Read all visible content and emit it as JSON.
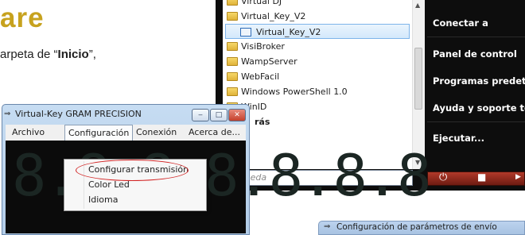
{
  "doc": {
    "title": "are",
    "text_prefix": "arpeta de “",
    "text_bold": "Inicio",
    "text_suffix": "”,",
    "title_color": "#c7a21e"
  },
  "start_menu": {
    "programs": [
      {
        "label": "Virtual DJ",
        "icon": "folder-icon"
      },
      {
        "label": "Virtual_Key_V2",
        "icon": "folder-icon"
      },
      {
        "label": "Virtual_Key_V2",
        "icon": "app-icon",
        "selected": true
      },
      {
        "label": "VisiBroker",
        "icon": "folder-icon"
      },
      {
        "label": "WampServer",
        "icon": "folder-icon"
      },
      {
        "label": "WebFacil",
        "icon": "folder-icon"
      },
      {
        "label": "Windows PowerShell 1.0",
        "icon": "folder-icon"
      },
      {
        "label": "WinID",
        "icon": "folder-icon"
      },
      {
        "label": "rás",
        "icon": "none"
      }
    ],
    "search_placeholder": "úsqueda",
    "right_items": [
      "Conectar a",
      "Panel de control",
      "Programas predeterm",
      "Ayuda y soporte técni",
      "Ejecutar..."
    ],
    "power_icon": "power-icon",
    "lock_icon": "lock-icon",
    "arrow_icon": "arrow-right-icon"
  },
  "vk_window": {
    "title": "Virtual-Key  GRAM PRECISION",
    "menu": [
      "Archivo",
      "Configuración",
      "Conexión",
      "Acerca de..."
    ],
    "display_digits": "8.8.8.8.8.8.8",
    "dropdown": [
      "Configurar transmisión",
      "Color Led",
      "Idioma"
    ]
  },
  "cfg_window": {
    "title": "Configuración de parámetros de envío"
  }
}
